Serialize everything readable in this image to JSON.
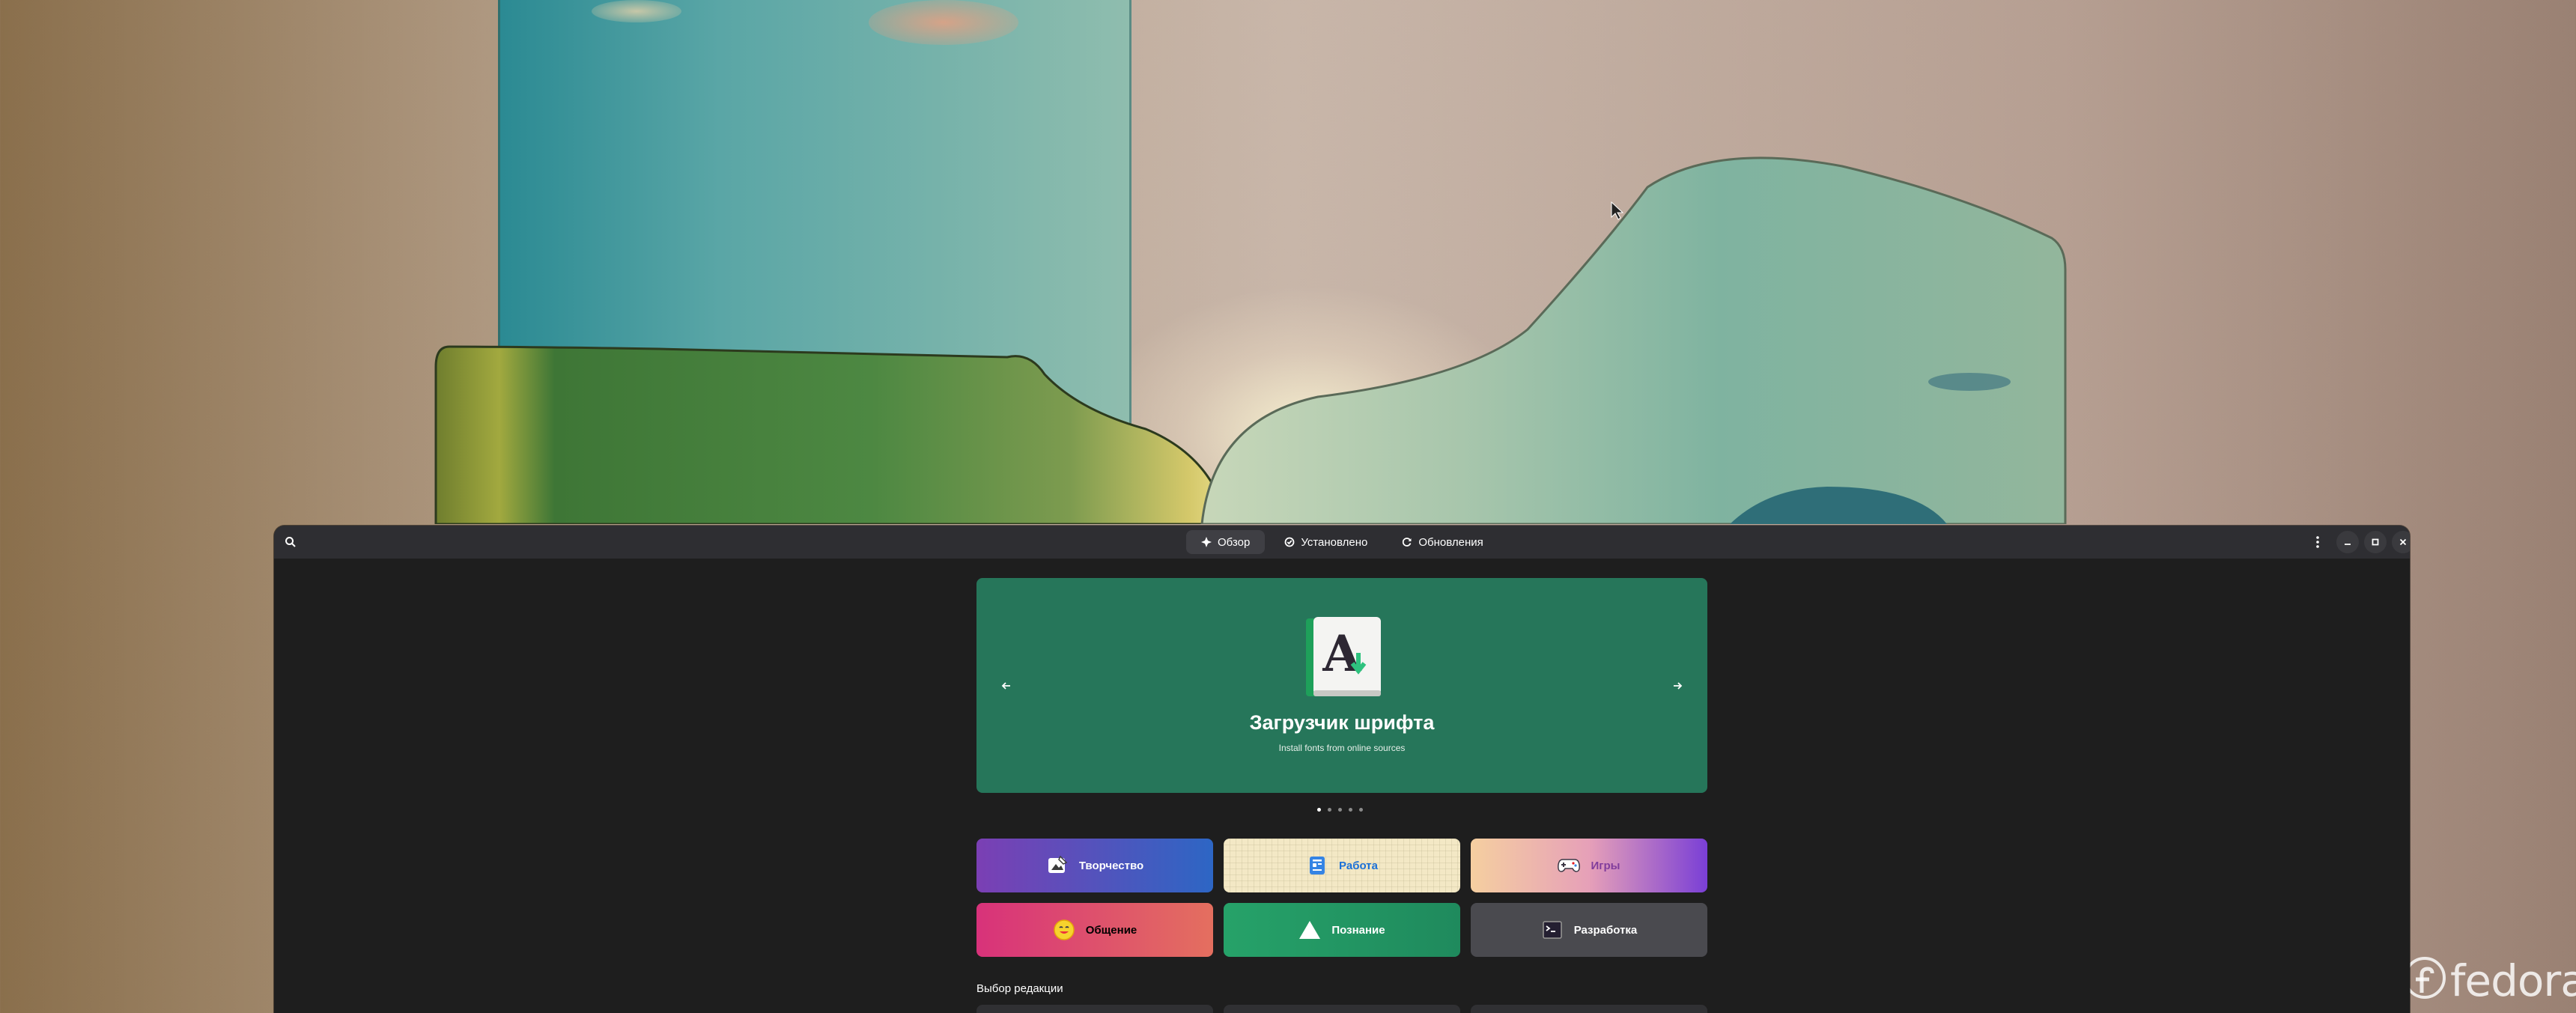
{
  "app": {
    "tabs": [
      {
        "label": "Обзор",
        "icon": "compass-icon",
        "active": true
      },
      {
        "label": "Установлено",
        "icon": "check-circle-icon",
        "active": false
      },
      {
        "label": "Обновления",
        "icon": "refresh-icon",
        "active": false
      }
    ],
    "header_icons": [
      "search-icon",
      "kebab-menu-icon",
      "minimize-icon",
      "maximize-icon",
      "close-icon"
    ]
  },
  "carousel": {
    "title": "Загрузчик шрифта",
    "subtitle": "Install fonts from online sources",
    "background": "#26765a",
    "slides_count": 5,
    "active_slide": 1
  },
  "categories": [
    {
      "label": "Творчество",
      "icon": "create-icon",
      "text_color": "#ffffff"
    },
    {
      "label": "Работа",
      "icon": "work-icon",
      "text_color": "#1c71d8"
    },
    {
      "label": "Игры",
      "icon": "gamepad-icon",
      "text_color": "#813d9c"
    },
    {
      "label": "Общение",
      "icon": "smiley-icon",
      "text_color": "#000000"
    },
    {
      "label": "Познание",
      "icon": "triangle-icon",
      "text_color": "#ffffff"
    },
    {
      "label": "Разработка",
      "icon": "terminal-icon",
      "text_color": "#ffffff"
    }
  ],
  "editors_choice": {
    "title": "Выбор редакции"
  },
  "desktop": {
    "watermark": "fedora"
  }
}
